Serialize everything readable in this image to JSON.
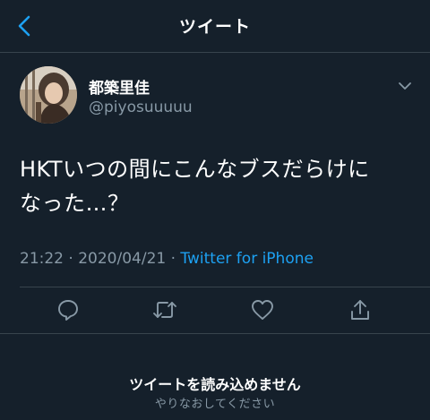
{
  "header": {
    "back_icon": "chevron-left-icon",
    "title": "ツイート"
  },
  "tweet": {
    "display_name": "都築里佳",
    "handle": "@piyosuuuuu",
    "text_line1": "HKTいつの間にこんなブスだらけに",
    "text_line2": "なった…？",
    "time": "21:22",
    "separator": " · ",
    "date": "2020/04/21",
    "source": "Twitter for iPhone",
    "more_icon": "chevron-down-icon"
  },
  "actions": [
    {
      "name": "reply",
      "icon": "comment-icon"
    },
    {
      "name": "retweet",
      "icon": "retweet-icon"
    },
    {
      "name": "like",
      "icon": "heart-icon"
    },
    {
      "name": "share",
      "icon": "share-icon"
    }
  ],
  "error": {
    "title": "ツイートを読み込めません",
    "subtitle": "やりなおしてください"
  },
  "colors": {
    "background": "#15202b",
    "accent": "#1da1f2",
    "secondary_text": "#8899a6",
    "divider": "#38444d"
  }
}
